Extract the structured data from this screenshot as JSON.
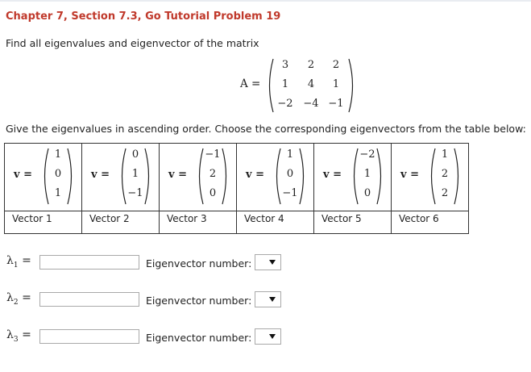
{
  "problem": {
    "title": "Chapter 7, Section 7.3, Go Tutorial Problem 19",
    "prompt": "Find all eigenvalues and eigenvector of the matrix",
    "matrix_label": "A =",
    "matrix": [
      [
        "3",
        "2",
        "2"
      ],
      [
        "1",
        "4",
        "1"
      ],
      [
        "−2",
        "−4",
        "−1"
      ]
    ],
    "instructions": "Give the eigenvalues in ascending order. Choose the corresponding eigenvectors from the table below:"
  },
  "vector_table": {
    "eq_label": "v =",
    "vectors": [
      {
        "label": "Vector 1",
        "entries": [
          "1",
          "0",
          "1"
        ]
      },
      {
        "label": "Vector 2",
        "entries": [
          "0",
          "1",
          "−1"
        ]
      },
      {
        "label": "Vector 3",
        "entries": [
          "−1",
          "2",
          "0"
        ]
      },
      {
        "label": "Vector 4",
        "entries": [
          "1",
          "0",
          "−1"
        ]
      },
      {
        "label": "Vector 5",
        "entries": [
          "−2",
          "1",
          "0"
        ]
      },
      {
        "label": "Vector 6",
        "entries": [
          "1",
          "2",
          "2"
        ]
      }
    ]
  },
  "answers": {
    "eigenvector_label": "Eigenvector number:",
    "rows": [
      {
        "lambda": "λ",
        "sub": "1",
        "eq": "=",
        "value": "",
        "selected": ""
      },
      {
        "lambda": "λ",
        "sub": "2",
        "eq": "=",
        "value": "",
        "selected": ""
      },
      {
        "lambda": "λ",
        "sub": "3",
        "eq": "=",
        "value": "",
        "selected": ""
      }
    ]
  },
  "colors": {
    "title": "#c0392b",
    "border": "#333333",
    "input_border": "#a9a9a9"
  }
}
